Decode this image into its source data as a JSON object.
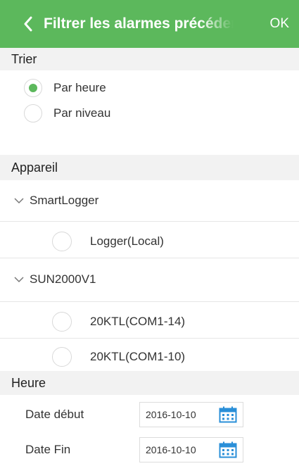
{
  "header": {
    "title": "Filtrer les alarmes précédent",
    "ok_label": "OK"
  },
  "sort": {
    "section_label": "Trier",
    "options": [
      {
        "label": "Par heure",
        "checked": true
      },
      {
        "label": "Par niveau",
        "checked": false
      }
    ]
  },
  "device": {
    "section_label": "Appareil",
    "groups": [
      {
        "name": "SmartLogger",
        "items": [
          "Logger(Local)"
        ]
      },
      {
        "name": "SUN2000V1",
        "items": [
          "20KTL(COM1-14)",
          "20KTL(COM1-10)"
        ]
      }
    ]
  },
  "time": {
    "section_label": "Heure",
    "start_label": "Date début",
    "start_value": "2016-10-10",
    "end_label": "Date Fin",
    "end_value": "2016-10-10"
  },
  "colors": {
    "accent": "#5cb85c",
    "calendar": "#2a8fd8"
  }
}
